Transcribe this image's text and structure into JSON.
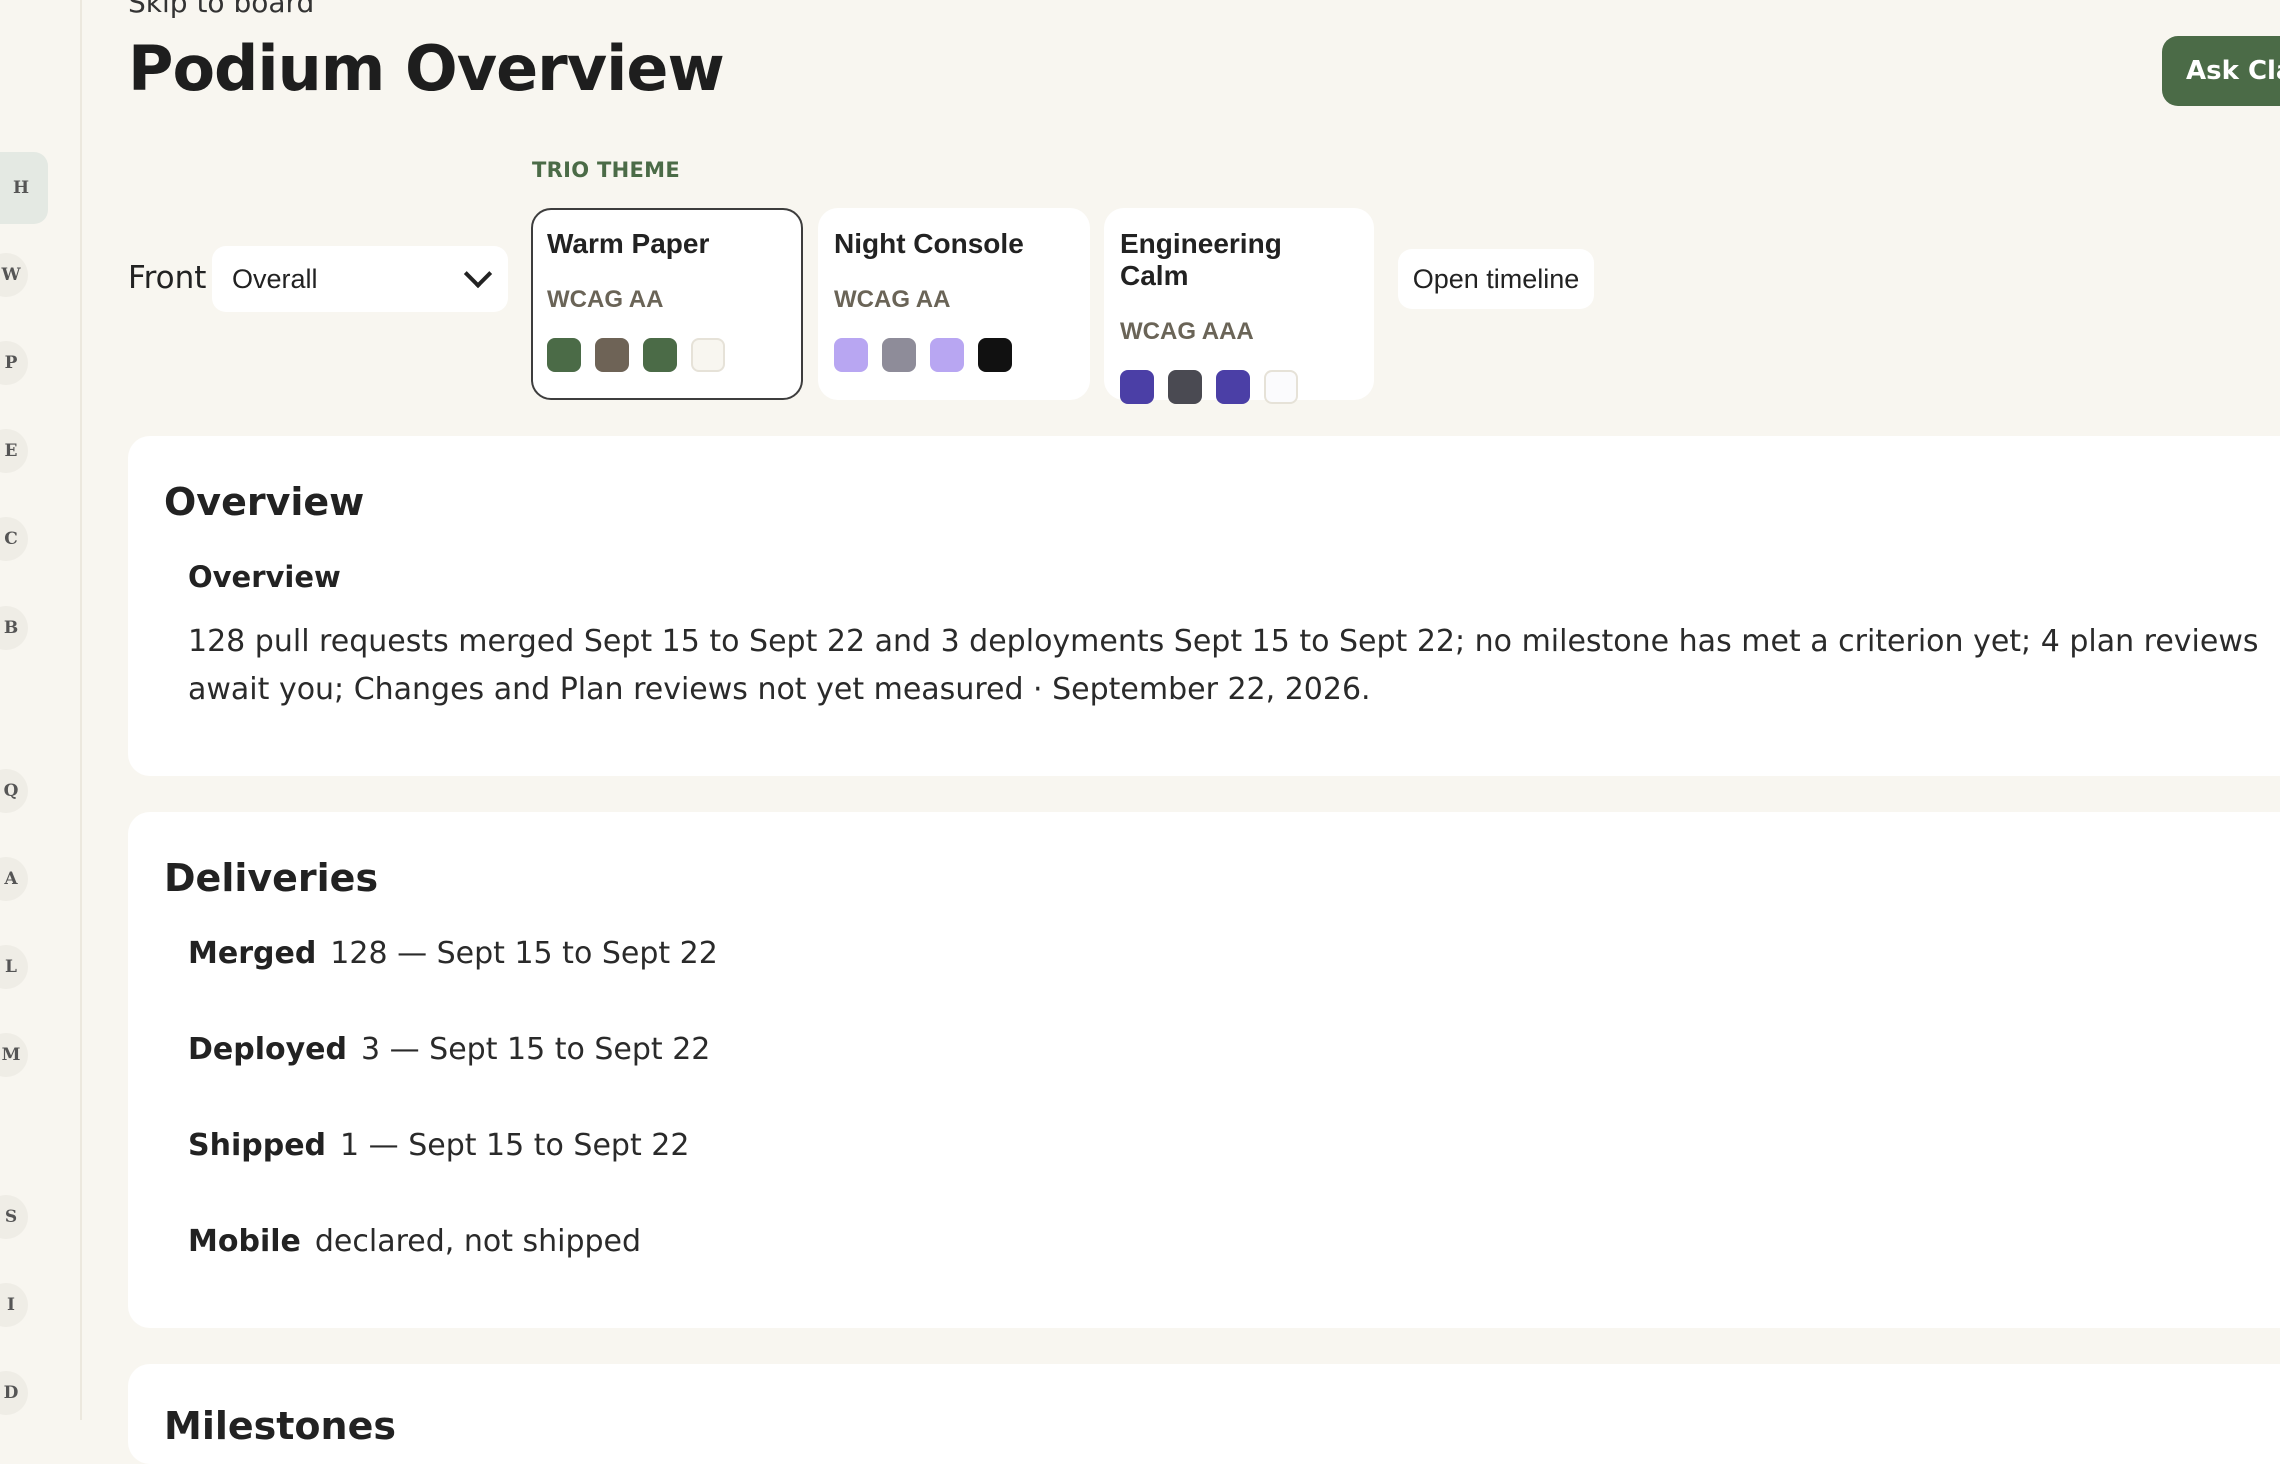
{
  "skip_link": "Skip to board",
  "page_title": "Podium Overview",
  "ask_button": "Ask Cla",
  "rail": [
    "H",
    "W",
    "P",
    "E",
    "C",
    "B",
    "Q",
    "A",
    "L",
    "M",
    "S",
    "I",
    "D"
  ],
  "rail_active": "H",
  "front": {
    "label": "Front",
    "value": "Overall"
  },
  "trio_theme": {
    "label": "TRIO THEME",
    "selected": "Warm Paper",
    "themes": [
      {
        "name": "Warm Paper",
        "wcag": "WCAG AA",
        "swatches": [
          "#4b6b47",
          "#6e6356",
          "#4b6b47",
          "#f8f6f0"
        ]
      },
      {
        "name": "Night Console",
        "wcag": "WCAG AA",
        "swatches": [
          "#b8a6f2",
          "#8e8c99",
          "#b8a6f2",
          "#111111"
        ]
      },
      {
        "name": "Engineering Calm",
        "wcag": "WCAG AAA",
        "swatches": [
          "#4b3fa6",
          "#4a4a52",
          "#4b3fa6",
          "#fbfbfd"
        ]
      }
    ]
  },
  "open_timeline": "Open timeline",
  "overview": {
    "title": "Overview",
    "subtitle": "Overview",
    "summary": "128 pull requests merged Sept 15 to Sept 22 and 3 deployments Sept 15 to Sept 22; no milestone has met a criterion yet; 4 plan reviews await you; Changes and Plan reviews not yet measured · September 22, 2026."
  },
  "deliveries": {
    "title": "Deliveries",
    "items": [
      {
        "label": "Merged",
        "value": "128 — Sept 15 to Sept 22"
      },
      {
        "label": "Deployed",
        "value": "3 — Sept 15 to Sept 22"
      },
      {
        "label": "Shipped",
        "value": "1 — Sept 15 to Sept 22"
      },
      {
        "label": "Mobile",
        "value": "declared, not shipped"
      }
    ]
  },
  "milestones": {
    "title": "Milestones"
  }
}
